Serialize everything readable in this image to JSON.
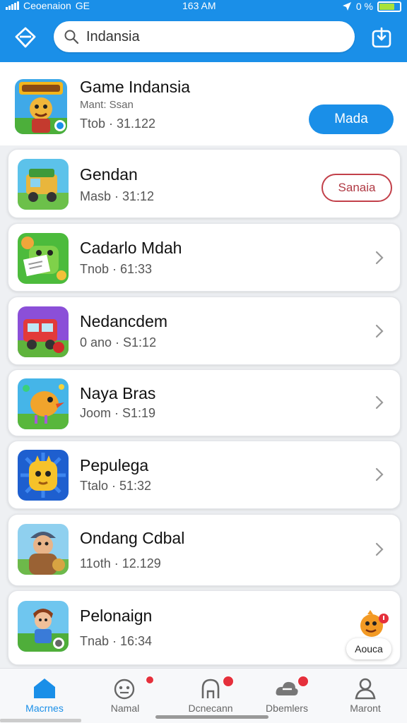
{
  "status_bar": {
    "carrier": "Ceoenaion",
    "network": "GE",
    "time": "163 AM",
    "battery_text": "0 %",
    "battery_level": 0.75
  },
  "header": {
    "search_placeholder": "Search",
    "search_value": "Indansia",
    "accent_color": "#1a8fe8"
  },
  "featured": {
    "name": "Game Indansia",
    "subtitle": "Mant: Ssan",
    "meta": "Ttob · 31.122",
    "button_label": "Mada",
    "icon": "game-banner-icon"
  },
  "apps": [
    {
      "name": "Gendan",
      "meta": "Masb · 31:12",
      "action": "Sanaia",
      "icon": "truck-game-icon"
    },
    {
      "name": "Cadarlo Mdah",
      "meta": "Tnob · 61:33",
      "icon": "frog-letter-icon"
    },
    {
      "name": "Nedancdem",
      "meta": "0 ano · S1:12",
      "icon": "red-truck-icon"
    },
    {
      "name": "Naya Bras",
      "meta": "Joom · S1:19",
      "icon": "cartoon-bird-icon"
    },
    {
      "name": "Pepulega",
      "meta": "Ttalo · 51:32",
      "icon": "yellow-face-icon"
    },
    {
      "name": "Ondang Cdbal",
      "meta": "11oth · 12.129",
      "icon": "adventurer-icon"
    },
    {
      "name": "Pelonaign",
      "meta": "Tnab · 16:34",
      "icon": "boy-character-icon"
    }
  ],
  "fab": {
    "label": "Aouca",
    "icon": "mascot-icon"
  },
  "nav": [
    {
      "label": "Macrnes",
      "icon": "home-icon",
      "active": true
    },
    {
      "label": "Namal",
      "icon": "games-icon",
      "badge": true
    },
    {
      "label": "Dcnecann",
      "icon": "apps-icon",
      "badge": true
    },
    {
      "label": "Dbemlers",
      "icon": "cloud-icon",
      "badge": true
    },
    {
      "label": "Maront",
      "icon": "profile-icon"
    }
  ]
}
